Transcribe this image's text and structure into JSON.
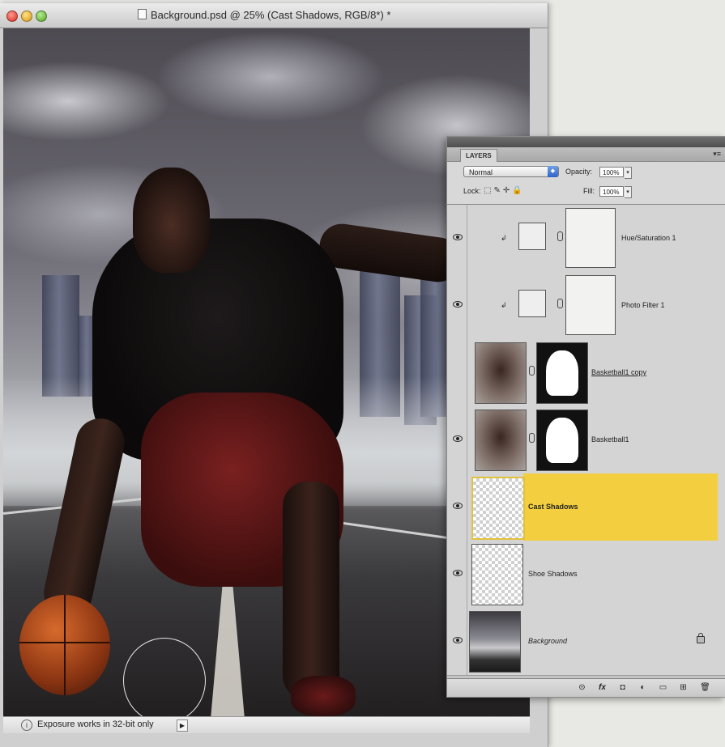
{
  "window": {
    "title": "Background.psd @ 25% (Cast Shadows, RGB/8*) *"
  },
  "statusbar": {
    "text": "Exposure works in 32-bit only",
    "info_glyph": "i",
    "arrow_glyph": "▶"
  },
  "layers_panel": {
    "tab_label": "LAYERS",
    "menu_glyph": "▾≡",
    "blend_mode": "Normal",
    "opacity_label": "Opacity:",
    "opacity_value": "100%",
    "lock_label": "Lock:",
    "lock_icons": "⬚✎✛🔒",
    "fill_label": "Fill:",
    "fill_value": "100%",
    "layers": [
      {
        "name": "Hue/Saturation 1",
        "visible": true,
        "type": "adjustment",
        "icon": "hue-saturation-icon"
      },
      {
        "name": "Photo Filter 1",
        "visible": true,
        "type": "adjustment",
        "icon": "photo-filter-icon"
      },
      {
        "name": "Basketball1 copy",
        "visible": false,
        "type": "image-with-mask"
      },
      {
        "name": "Basketball1",
        "visible": true,
        "type": "image-with-mask"
      },
      {
        "name": "Cast Shadows",
        "visible": true,
        "type": "transparent",
        "selected": true
      },
      {
        "name": "Shoe Shadows",
        "visible": true,
        "type": "transparent"
      },
      {
        "name": "Background",
        "visible": true,
        "type": "image",
        "locked": true
      }
    ],
    "footer_buttons": [
      "link-layers-icon",
      "fx-icon",
      "add-mask-icon",
      "adjustment-layer-icon",
      "new-group-icon",
      "new-layer-icon",
      "trash-icon"
    ],
    "footer_glyphs": [
      "⊝",
      "fx",
      "◘",
      "◐",
      "▭",
      "⊞",
      "🗑"
    ]
  },
  "colors": {
    "selected_layer_highlight": "#f3cf3f",
    "caret_blue": "#2f64c7"
  }
}
